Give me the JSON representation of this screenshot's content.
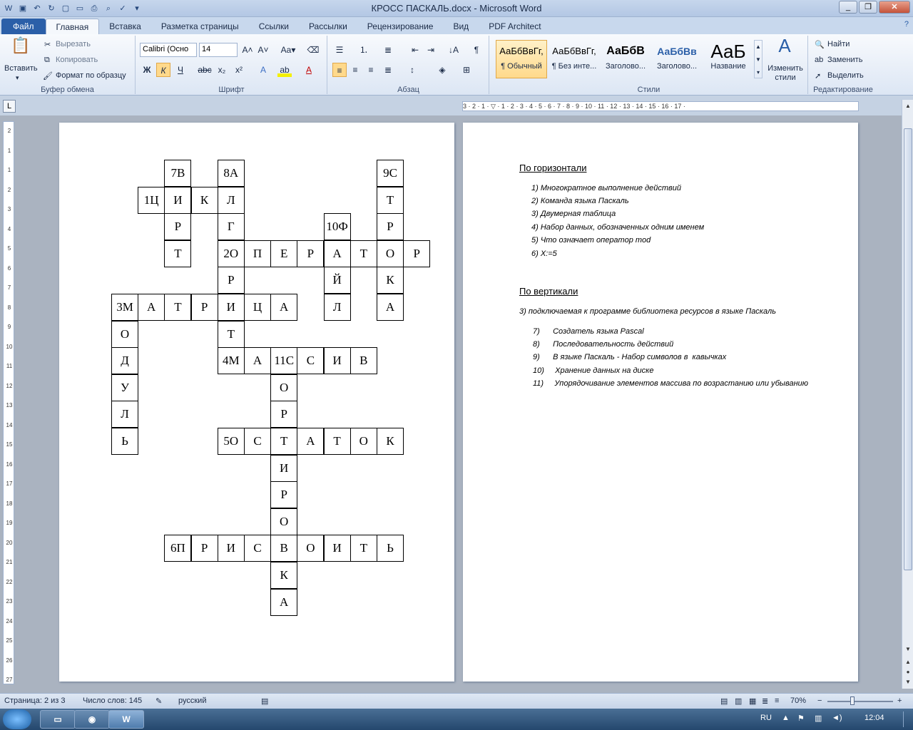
{
  "window": {
    "title": "КРОСС ПАСКАЛЬ.docx - Microsoft Word"
  },
  "tabs": [
    {
      "label": "Файл"
    },
    {
      "label": "Главная"
    },
    {
      "label": "Вставка"
    },
    {
      "label": "Разметка страницы"
    },
    {
      "label": "Ссылки"
    },
    {
      "label": "Рассылки"
    },
    {
      "label": "Рецензирование"
    },
    {
      "label": "Вид"
    },
    {
      "label": "PDF Architect"
    }
  ],
  "ribbon": {
    "clipboard": {
      "paste": "Вставить",
      "cut": "Вырезать",
      "copy": "Копировать",
      "format_painter": "Формат по образцу",
      "label": "Буфер обмена"
    },
    "font": {
      "name": "Calibri (Осно",
      "size": "14",
      "label": "Шрифт"
    },
    "paragraph": {
      "label": "Абзац"
    },
    "styles": {
      "items": [
        {
          "preview": "АаБбВвГг,",
          "name": "¶ Обычный"
        },
        {
          "preview": "АаБбВвГг,",
          "name": "¶ Без инте..."
        },
        {
          "preview": "АаБбВ",
          "name": "Заголово..."
        },
        {
          "preview": "АаБбВв",
          "name": "Заголово..."
        },
        {
          "preview": "АаБ",
          "name": "Название"
        }
      ],
      "change": "Изменить стили",
      "label": "Стили"
    },
    "editing": {
      "find": "Найти",
      "replace": "Заменить",
      "select": "Выделить",
      "label": "Редактирование"
    }
  },
  "ruler": {
    "text": "3 · 2 · 1 · ▽ · 1 · 2 · 3 · 4 · 5 · 6 · 7 · 8 · 9 · 10 · 11 · 12 · 13 · 14 · 15 · 16 · 17 ·"
  },
  "crossword": {
    "cells": [
      {
        "r": 0,
        "c": 2,
        "t": "7В"
      },
      {
        "r": 0,
        "c": 4,
        "t": "8А"
      },
      {
        "r": 0,
        "c": 10,
        "t": "9С"
      },
      {
        "r": 1,
        "c": 1,
        "t": "1Ц"
      },
      {
        "r": 1,
        "c": 2,
        "t": "И"
      },
      {
        "r": 1,
        "c": 3,
        "t": "К"
      },
      {
        "r": 1,
        "c": 4,
        "t": "Л"
      },
      {
        "r": 1,
        "c": 10,
        "t": "Т"
      },
      {
        "r": 2,
        "c": 2,
        "t": "Р"
      },
      {
        "r": 2,
        "c": 4,
        "t": "Г"
      },
      {
        "r": 2,
        "c": 8,
        "t": "10Ф"
      },
      {
        "r": 2,
        "c": 10,
        "t": "Р"
      },
      {
        "r": 3,
        "c": 2,
        "t": "Т"
      },
      {
        "r": 3,
        "c": 4,
        "t": "2О"
      },
      {
        "r": 3,
        "c": 5,
        "t": "П"
      },
      {
        "r": 3,
        "c": 6,
        "t": "Е"
      },
      {
        "r": 3,
        "c": 7,
        "t": "Р"
      },
      {
        "r": 3,
        "c": 8,
        "t": "А"
      },
      {
        "r": 3,
        "c": 9,
        "t": "Т"
      },
      {
        "r": 3,
        "c": 10,
        "t": "О"
      },
      {
        "r": 3,
        "c": 11,
        "t": "Р"
      },
      {
        "r": 4,
        "c": 4,
        "t": "Р"
      },
      {
        "r": 4,
        "c": 8,
        "t": "Й"
      },
      {
        "r": 4,
        "c": 10,
        "t": "К"
      },
      {
        "r": 5,
        "c": 0,
        "t": "3М"
      },
      {
        "r": 5,
        "c": 1,
        "t": "А"
      },
      {
        "r": 5,
        "c": 2,
        "t": "Т"
      },
      {
        "r": 5,
        "c": 3,
        "t": "Р"
      },
      {
        "r": 5,
        "c": 4,
        "t": "И"
      },
      {
        "r": 5,
        "c": 5,
        "t": "Ц"
      },
      {
        "r": 5,
        "c": 6,
        "t": "А"
      },
      {
        "r": 5,
        "c": 8,
        "t": "Л"
      },
      {
        "r": 5,
        "c": 10,
        "t": "А"
      },
      {
        "r": 6,
        "c": 0,
        "t": "О"
      },
      {
        "r": 6,
        "c": 4,
        "t": "Т"
      },
      {
        "r": 7,
        "c": 0,
        "t": "Д"
      },
      {
        "r": 7,
        "c": 4,
        "t": "4М"
      },
      {
        "r": 7,
        "c": 5,
        "t": "А"
      },
      {
        "r": 7,
        "c": 6,
        "t": "11С"
      },
      {
        "r": 7,
        "c": 7,
        "t": "С"
      },
      {
        "r": 7,
        "c": 8,
        "t": "И"
      },
      {
        "r": 7,
        "c": 9,
        "t": "В"
      },
      {
        "r": 8,
        "c": 0,
        "t": "У"
      },
      {
        "r": 8,
        "c": 6,
        "t": "О"
      },
      {
        "r": 9,
        "c": 0,
        "t": "Л"
      },
      {
        "r": 9,
        "c": 6,
        "t": "Р"
      },
      {
        "r": 10,
        "c": 0,
        "t": "Ь"
      },
      {
        "r": 10,
        "c": 4,
        "t": "5О"
      },
      {
        "r": 10,
        "c": 5,
        "t": "С"
      },
      {
        "r": 10,
        "c": 6,
        "t": "Т"
      },
      {
        "r": 10,
        "c": 7,
        "t": "А"
      },
      {
        "r": 10,
        "c": 8,
        "t": "Т"
      },
      {
        "r": 10,
        "c": 9,
        "t": "О"
      },
      {
        "r": 10,
        "c": 10,
        "t": "К"
      },
      {
        "r": 11,
        "c": 6,
        "t": "И"
      },
      {
        "r": 12,
        "c": 6,
        "t": "Р"
      },
      {
        "r": 13,
        "c": 6,
        "t": "О"
      },
      {
        "r": 14,
        "c": 2,
        "t": "6П"
      },
      {
        "r": 14,
        "c": 3,
        "t": "Р"
      },
      {
        "r": 14,
        "c": 4,
        "t": "И"
      },
      {
        "r": 14,
        "c": 5,
        "t": "С"
      },
      {
        "r": 14,
        "c": 6,
        "t": "В"
      },
      {
        "r": 14,
        "c": 7,
        "t": "О"
      },
      {
        "r": 14,
        "c": 8,
        "t": "И"
      },
      {
        "r": 14,
        "c": 9,
        "t": "Т"
      },
      {
        "r": 14,
        "c": 10,
        "t": "Ь"
      },
      {
        "r": 15,
        "c": 6,
        "t": "К"
      },
      {
        "r": 16,
        "c": 6,
        "t": "А"
      }
    ]
  },
  "clues": {
    "horizontal_title": "По горизонтали",
    "horizontal": [
      "1)  Многократное выполнение действий",
      "2)  Команда языка Паскаль",
      "3)  Двумерная таблица",
      "4)  Набор данных, обозначенных одним именем",
      "5)  Что означает оператор mod",
      "6)  X:=5"
    ],
    "vertical_title": "По вертикали",
    "vertical_intro": "3) подключаемая к программе библиотека ресурсов в языке Паскаль",
    "vertical": [
      "7)      Создатель языка Pascal",
      "8)      Последовательность действий",
      "9)      В языке Паскаль - Набор символов в  кавычках",
      "10)     Хранение данных на диске",
      "11)     Упорядочивание элементов массива по возрастанию или убыванию"
    ]
  },
  "status": {
    "page": "Страница: 2 из 3",
    "words": "Число слов: 145",
    "lang": "русский",
    "zoom": "70%",
    "zoom_minus": "−",
    "zoom_plus": "+"
  },
  "taskbar": {
    "lang": "RU",
    "time": "12:04",
    "word_app": "W"
  },
  "ruler_vertical": [
    "2",
    "1",
    "1",
    "2",
    "3",
    "4",
    "5",
    "6",
    "7",
    "8",
    "9",
    "10",
    "11",
    "12",
    "13",
    "14",
    "15",
    "16",
    "17",
    "18",
    "19",
    "20",
    "21",
    "22",
    "23",
    "24",
    "25",
    "26",
    "27"
  ]
}
